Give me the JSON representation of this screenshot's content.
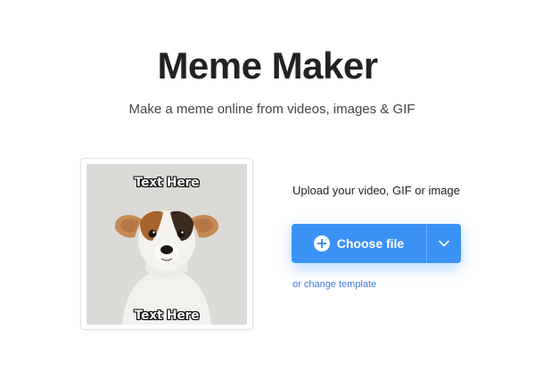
{
  "header": {
    "title": "Meme Maker",
    "subtitle": "Make a meme online from videos, images & GIF"
  },
  "preview": {
    "top_caption": "Text Here",
    "bottom_caption": "Text Here"
  },
  "upload": {
    "label": "Upload your video, GIF or image",
    "choose_file_label": "Choose file",
    "change_template_link": "or change template"
  },
  "colors": {
    "accent": "#3b92f5",
    "link": "#3b7fd6",
    "title": "#222222"
  },
  "icons": {
    "plus": "plus-circle-icon",
    "dropdown": "chevron-down-icon"
  }
}
